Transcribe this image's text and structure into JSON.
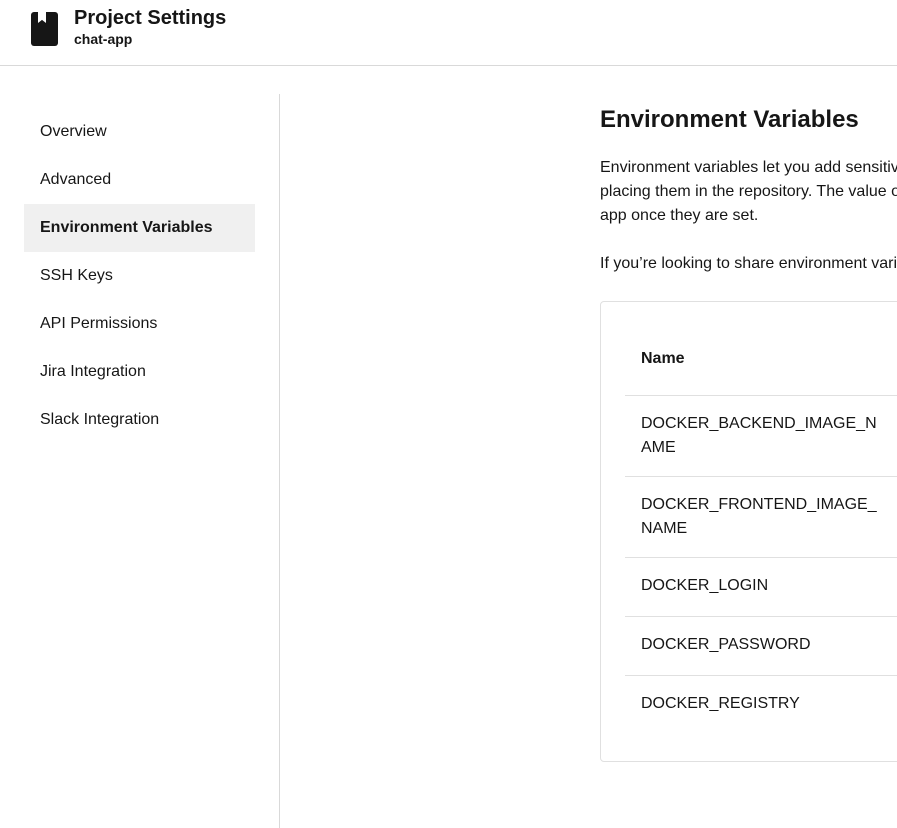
{
  "header": {
    "title": "Project Settings",
    "project": "chat-app"
  },
  "sidebar": {
    "items": [
      {
        "label": "Overview"
      },
      {
        "label": "Advanced"
      },
      {
        "label": "Environment Variables",
        "active": true
      },
      {
        "label": "SSH Keys"
      },
      {
        "label": "API Permissions"
      },
      {
        "label": "Jira Integration"
      },
      {
        "label": "Slack Integration"
      }
    ]
  },
  "main": {
    "title": "Environment Variables",
    "description_lines": [
      "Environment variables let you add sensitiv",
      "placing them in the repository. The value o",
      "app once they are set."
    ],
    "share_note": "If you’re looking to share environment vari",
    "table": {
      "column_name": "Name",
      "rows": [
        {
          "name": "DOCKER_BACKEND_IMAGE_NAME"
        },
        {
          "name": "DOCKER_FRONTEND_IMAGE_NAME"
        },
        {
          "name": "DOCKER_LOGIN"
        },
        {
          "name": "DOCKER_PASSWORD"
        },
        {
          "name": "DOCKER_REGISTRY"
        }
      ]
    }
  }
}
